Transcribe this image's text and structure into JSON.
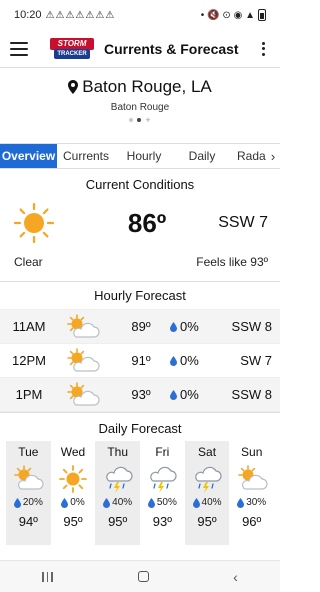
{
  "status_bar": {
    "time": "10:20",
    "warnings": "⚠⚠⚠⚠⚠⚠⚠",
    "dot": "•",
    "right_icons": "🔇 ⊙ ◉ ▲"
  },
  "app_bar": {
    "title": "Currents & Forecast",
    "logo_top": "STORM",
    "logo_bottom": "TRACKER"
  },
  "location": {
    "name": "Baton Rouge, LA",
    "sub": "Baton Rouge",
    "page_count": 2,
    "active_page": 1
  },
  "tabs": [
    {
      "label": "Overview",
      "active": true
    },
    {
      "label": "Currents",
      "active": false
    },
    {
      "label": "Hourly",
      "active": false
    },
    {
      "label": "Daily",
      "active": false
    },
    {
      "label": "Radar",
      "active": false
    }
  ],
  "current": {
    "header": "Current Conditions",
    "temp": "86º",
    "wind": "SSW  7",
    "condition": "Clear",
    "feels_like": "Feels like 93º",
    "icon": "sun-icon"
  },
  "hourly": {
    "header": "Hourly Forecast",
    "rows": [
      {
        "time": "11AM",
        "icon": "partly-cloudy-icon",
        "temp": "89º",
        "precip": "0%",
        "wind": "SSW  8"
      },
      {
        "time": "12PM",
        "icon": "partly-cloudy-icon",
        "temp": "91º",
        "precip": "0%",
        "wind": "SW  7"
      },
      {
        "time": "1PM",
        "icon": "partly-cloudy-icon",
        "temp": "93º",
        "precip": "0%",
        "wind": "SSW  8"
      }
    ]
  },
  "daily": {
    "header": "Daily Forecast",
    "days": [
      {
        "day": "Tue",
        "icon": "partly-cloudy-icon",
        "precip": "20%",
        "temp": "94º"
      },
      {
        "day": "Wed",
        "icon": "sun-icon",
        "precip": "0%",
        "temp": "95º"
      },
      {
        "day": "Thu",
        "icon": "thunderstorm-icon",
        "precip": "40%",
        "temp": "95º"
      },
      {
        "day": "Fri",
        "icon": "thunderstorm-icon",
        "precip": "50%",
        "temp": "93º"
      },
      {
        "day": "Sat",
        "icon": "thunderstorm-icon",
        "precip": "40%",
        "temp": "95º"
      },
      {
        "day": "Sun",
        "icon": "partly-cloudy-icon",
        "precip": "30%",
        "temp": "96º"
      }
    ]
  },
  "colors": {
    "accent": "#1f6bd6",
    "sun": "#f5a623",
    "drop": "#2b6fd4",
    "bolt": "#f2c200",
    "cloud": "#b8c0c8"
  }
}
